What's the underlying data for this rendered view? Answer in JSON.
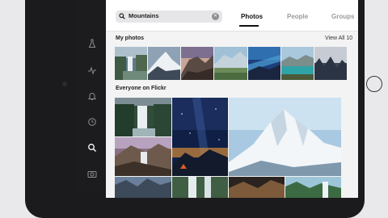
{
  "search": {
    "query": "Mountains"
  },
  "tabs": [
    {
      "label": "Photos",
      "active": true
    },
    {
      "label": "People",
      "active": false
    },
    {
      "label": "Groups",
      "active": false
    }
  ],
  "my_photos": {
    "title": "My photos",
    "view_all": "View All 10"
  },
  "everyone": {
    "title": "Everyone on Flickr"
  },
  "sidebar": {
    "icons": [
      "flask-icon",
      "activity-icon",
      "notification-bell-icon",
      "clock-icon",
      "search-icon",
      "camera-icon"
    ],
    "active": "search-icon"
  },
  "colors": {
    "sidebar": "#1c1c1e",
    "accent_text": "#111111",
    "muted_tab": "#9a9a9f"
  }
}
